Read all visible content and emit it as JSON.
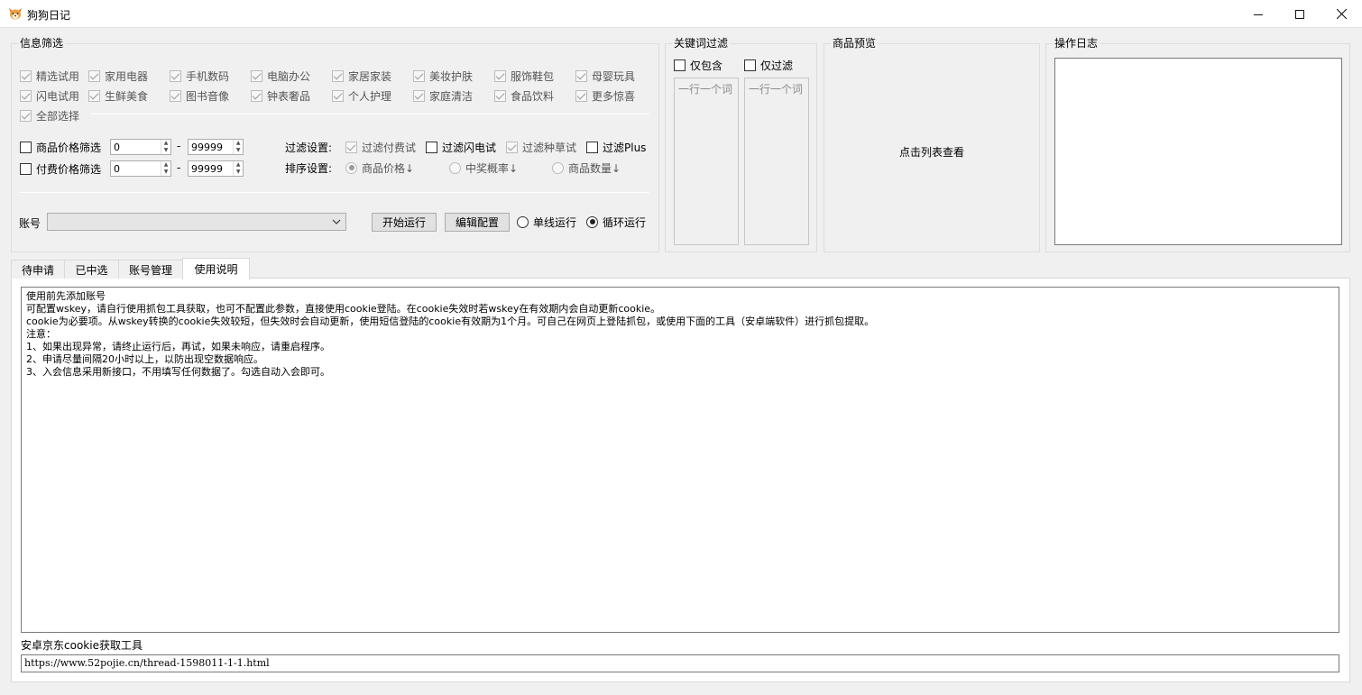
{
  "window": {
    "title": "狗狗日记"
  },
  "filter": {
    "title": "信息筛选",
    "categories_row1": [
      "精选试用",
      "家用电器",
      "手机数码",
      "电脑办公",
      "家居家装",
      "美妆护肤",
      "服饰鞋包",
      "母婴玩具"
    ],
    "categories_row2": [
      "闪电试用",
      "生鲜美食",
      "图书音像",
      "钟表奢品",
      "个人护理",
      "家庭清洁",
      "食品饮料",
      "更多惊喜"
    ],
    "select_all": "全部选择",
    "price_filter_label": "商品价格筛选",
    "paid_filter_label": "付费价格筛选",
    "price_min": "0",
    "price_max": "99999",
    "paid_min": "0",
    "paid_max": "99999",
    "dash": "-",
    "filter_settings_label": "过滤设置:",
    "filter_options": [
      "过滤付费试",
      "过滤闪电试",
      "过滤种草试",
      "过滤Plus"
    ],
    "sort_label": "排序设置:",
    "sort_options": [
      "商品价格↓",
      "中奖概率↓",
      "商品数量↓"
    ],
    "account_label": "账号",
    "start_button": "开始运行",
    "edit_button": "编辑配置",
    "run_single": "单线运行",
    "run_loop": "循环运行"
  },
  "keywords": {
    "title": "关键词过滤",
    "include_only": "仅包含",
    "exclude_only": "仅过滤",
    "include_placeholder": "一行一个词",
    "exclude_placeholder": "一行一个词"
  },
  "preview": {
    "title": "商品预览",
    "hint": "点击列表查看"
  },
  "log": {
    "title": "操作日志"
  },
  "tabs": [
    "待申请",
    "已中选",
    "账号管理",
    "使用说明"
  ],
  "instructions": [
    "使用前先添加账号",
    "",
    "可配置wskey，请自行使用抓包工具获取，也可不配置此参数，直接使用cookie登陆。在cookie失效时若wskey在有效期内会自动更新cookie。",
    "",
    "cookie为必要项。从wskey转换的cookie失效较短，但失效时会自动更新，使用短信登陆的cookie有效期为1个月。可自己在网页上登陆抓包，或使用下面的工具（安卓端软件）进行抓包提取。",
    "",
    "注意：",
    "1、如果出现异常，请终止运行后，再试，如果未响应，请重启程序。",
    "2、申请尽量间隔20小时以上，以防出现空数据响应。",
    "3、入会信息采用新接口，不用填写任何数据了。勾选自动入会即可。"
  ],
  "tool": {
    "label": "安卓京东cookie获取工具",
    "url": "https://www.52pojie.cn/thread-1598011-1-1.html"
  }
}
